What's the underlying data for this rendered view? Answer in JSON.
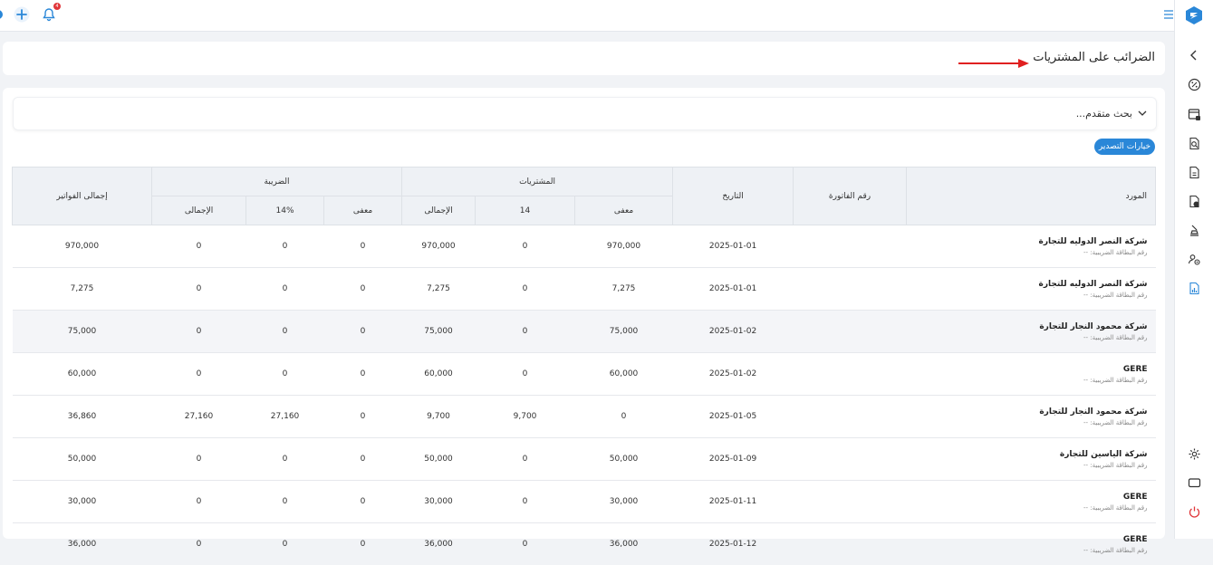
{
  "colors": {
    "accent": "#2a87d8",
    "badge": "#e0363a",
    "arrow": "#e02020"
  },
  "topbar": {
    "icons": [
      "panel-edge-icon",
      "plus-icon",
      "bell-icon"
    ],
    "notification_count": "4"
  },
  "sidebar": {
    "icons": [
      "chevron-left-icon",
      "percent-icon",
      "receipt-icon",
      "search-document-icon",
      "document-icon",
      "document-money-icon",
      "stamp-icon",
      "users-settings-icon",
      "chart-report-icon",
      "settings-icon",
      "screen-icon",
      "power-icon"
    ],
    "active": "chart-report-icon"
  },
  "page": {
    "title": "الضرائب على المشتريات"
  },
  "advanced_search": {
    "label": "بحث متقدم..."
  },
  "export_button": {
    "label": "خيارات التصدير"
  },
  "table": {
    "headers": {
      "supplier": "المورد",
      "invoice_no": "رقم الفاتورة",
      "date": "التاريخ",
      "purchases": "المشتريات",
      "tax": "الضريبة",
      "invoices_total": "إجمالى الفواتير"
    },
    "purchases_sub": [
      "معفى",
      "14",
      "الإجمالى"
    ],
    "tax_sub": [
      "معفى",
      "14%",
      "الإجمالى"
    ],
    "rows": [
      {
        "supplier": "شركة النصر الدوليه للتجارة",
        "tax_id": "رقم البطاقة الضريبية: --",
        "invoice": "",
        "date": "2025-01-01",
        "p_exempt": "970,000",
        "p_14": "0",
        "p_total": "970,000",
        "t_exempt": "0",
        "t_14": "0",
        "t_total": "0",
        "grand": "970,000"
      },
      {
        "supplier": "شركة النصر الدوليه للتجارة",
        "tax_id": "رقم البطاقة الضريبية: --",
        "invoice": "",
        "date": "2025-01-01",
        "p_exempt": "7,275",
        "p_14": "0",
        "p_total": "7,275",
        "t_exempt": "0",
        "t_14": "0",
        "t_total": "0",
        "grand": "7,275"
      },
      {
        "supplier": "شركة محمود النجار للتجارة",
        "tax_id": "رقم البطاقة الضريبية: --",
        "invoice": "",
        "date": "2025-01-02",
        "p_exempt": "75,000",
        "p_14": "0",
        "p_total": "75,000",
        "t_exempt": "0",
        "t_14": "0",
        "t_total": "0",
        "grand": "75,000"
      },
      {
        "supplier": "GERE",
        "tax_id": "رقم البطاقة الضريبية: --",
        "invoice": "",
        "date": "2025-01-02",
        "p_exempt": "60,000",
        "p_14": "0",
        "p_total": "60,000",
        "t_exempt": "0",
        "t_14": "0",
        "t_total": "0",
        "grand": "60,000"
      },
      {
        "supplier": "شركة محمود النجار للتجارة",
        "tax_id": "رقم البطاقة الضريبية: --",
        "invoice": "",
        "date": "2025-01-05",
        "p_exempt": "0",
        "p_14": "9,700",
        "p_total": "9,700",
        "t_exempt": "0",
        "t_14": "27,160",
        "t_total": "27,160",
        "grand": "36,860"
      },
      {
        "supplier": "شركة الياسين للتجارة",
        "tax_id": "رقم البطاقة الضريبية: --",
        "invoice": "",
        "date": "2025-01-09",
        "p_exempt": "50,000",
        "p_14": "0",
        "p_total": "50,000",
        "t_exempt": "0",
        "t_14": "0",
        "t_total": "0",
        "grand": "50,000"
      },
      {
        "supplier": "GERE",
        "tax_id": "رقم البطاقة الضريبية: --",
        "invoice": "",
        "date": "2025-01-11",
        "p_exempt": "30,000",
        "p_14": "0",
        "p_total": "30,000",
        "t_exempt": "0",
        "t_14": "0",
        "t_total": "0",
        "grand": "30,000"
      },
      {
        "supplier": "GERE",
        "tax_id": "رقم البطاقة الضريبية: --",
        "invoice": "",
        "date": "2025-01-12",
        "p_exempt": "36,000",
        "p_14": "0",
        "p_total": "36,000",
        "t_exempt": "0",
        "t_14": "0",
        "t_total": "0",
        "grand": "36,000"
      }
    ]
  }
}
